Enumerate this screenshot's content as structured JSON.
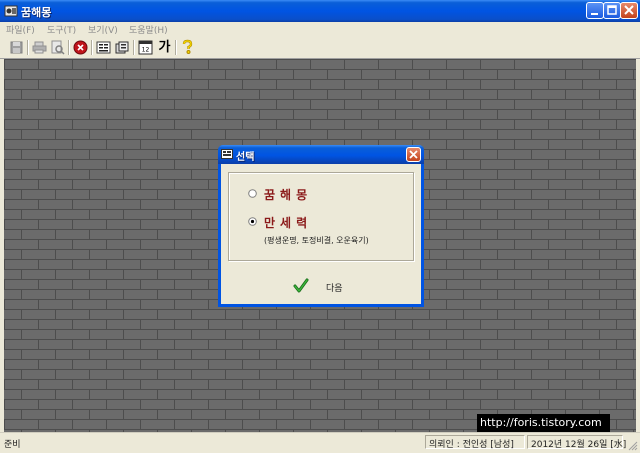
{
  "window": {
    "title": "꿈해몽",
    "icon": "app-icon"
  },
  "menu": {
    "items": [
      "파일(F)",
      "도구(T)",
      "보기(V)",
      "도움말(H)"
    ]
  },
  "toolbar": {
    "buttons": [
      "save-icon",
      "print-icon",
      "print-preview-icon",
      "stop-icon",
      "list-icon",
      "cards-icon",
      "calendar-icon",
      "font-icon",
      "help-icon"
    ],
    "calendar_number": "12",
    "font_glyph": "가"
  },
  "dialog": {
    "title": "선택",
    "options": [
      {
        "label": "꿈해몽",
        "sub": "",
        "selected": false
      },
      {
        "label": "만세력",
        "sub": "(평생운명, 토정비결, 오운육기)",
        "selected": true
      }
    ],
    "next_label": "다음"
  },
  "watermark": "http://foris.tistory.com",
  "status": {
    "ready": "준비",
    "requester": "의뢰인 : 전인성 [남성]",
    "date": "2012년 12월 26일 [水]"
  },
  "colors": {
    "titlebar": "#0054e3",
    "option_text": "#8b1a1a",
    "workspace": "#6a6a6a"
  }
}
